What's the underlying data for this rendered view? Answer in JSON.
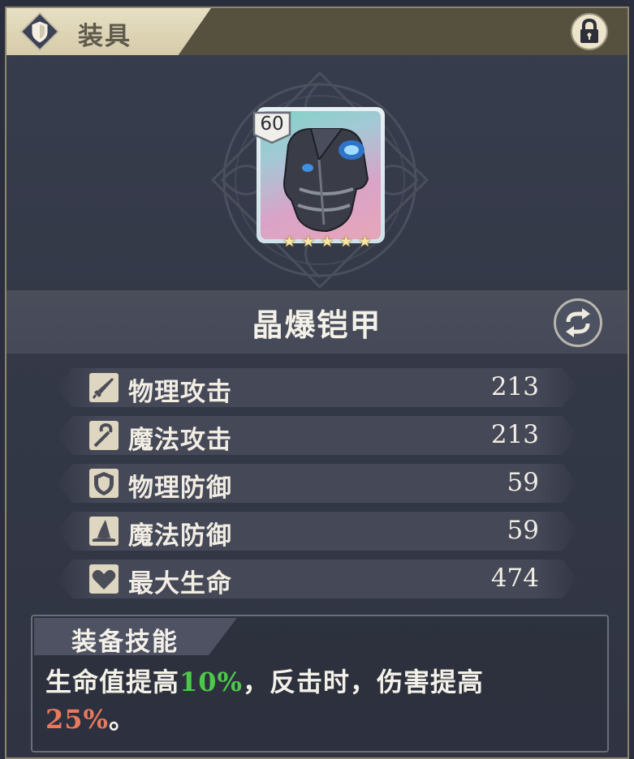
{
  "header": {
    "title": "装具",
    "emblem_icon": "shield-icon",
    "lock_icon": "lock-icon"
  },
  "item": {
    "level": "60",
    "stars": 5,
    "name": "晶爆铠甲",
    "image_icon": "armor-chestplate-icon",
    "swap_icon": "swap-arrows-icon"
  },
  "stats": [
    {
      "icon": "sword-icon",
      "label": "物理攻击",
      "value": "213"
    },
    {
      "icon": "staff-icon",
      "label": "魔法攻击",
      "value": "213"
    },
    {
      "icon": "shield-icon",
      "label": "物理防御",
      "value": "59"
    },
    {
      "icon": "wizard-hat-icon",
      "label": "魔法防御",
      "value": "59"
    },
    {
      "icon": "heart-icon",
      "label": "最大生命",
      "value": "474"
    }
  ],
  "skill": {
    "title": "装备技能",
    "desc_part1": "生命值提高",
    "desc_pct1": "10%",
    "desc_part2": "，反击时，伤害提高",
    "desc_pct2": "25%",
    "desc_part3": "。"
  },
  "colors": {
    "accent_gold": "#d6cca9",
    "highlight_green": "#4ec84a",
    "highlight_red": "#e9795b"
  }
}
